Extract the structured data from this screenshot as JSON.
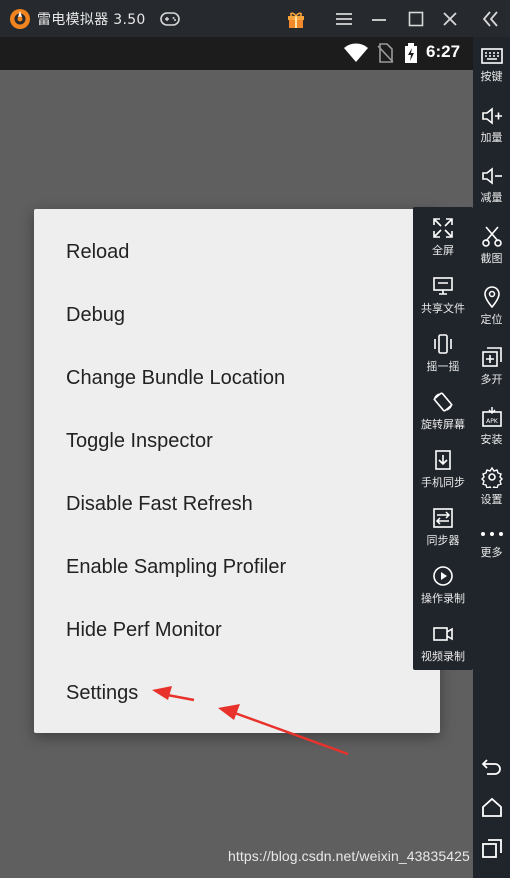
{
  "window": {
    "title": "雷电模拟器 3.50"
  },
  "statusbar": {
    "time": "6:27"
  },
  "dev_menu": {
    "items": [
      "Reload",
      "Debug",
      "Change Bundle Location",
      "Toggle Inspector",
      "Disable Fast Refresh",
      "Enable Sampling Profiler",
      "Hide Perf Monitor",
      "Settings"
    ]
  },
  "float_toolbar": {
    "items": [
      {
        "label": "全屏",
        "icon": "fullscreen-icon"
      },
      {
        "label": "共享文件",
        "icon": "share-files-icon"
      },
      {
        "label": "摇一摇",
        "icon": "shake-icon"
      },
      {
        "label": "旋转屏幕",
        "icon": "rotate-screen-icon"
      },
      {
        "label": "手机同步",
        "icon": "phone-sync-icon"
      },
      {
        "label": "同步器",
        "icon": "synchronizer-icon"
      },
      {
        "label": "操作录制",
        "icon": "operation-record-icon"
      },
      {
        "label": "视频录制",
        "icon": "video-record-icon"
      }
    ]
  },
  "sidebar": {
    "items": [
      {
        "label": "按键",
        "icon": "keyboard-icon"
      },
      {
        "label": "加量",
        "icon": "volume-up-icon"
      },
      {
        "label": "减量",
        "icon": "volume-down-icon"
      },
      {
        "label": "截图",
        "icon": "screenshot-icon"
      },
      {
        "label": "定位",
        "icon": "location-icon"
      },
      {
        "label": "多开",
        "icon": "multi-instance-icon"
      },
      {
        "label": "安装",
        "icon": "install-apk-icon"
      },
      {
        "label": "设置",
        "icon": "settings-gear-icon"
      },
      {
        "label": "更多",
        "icon": "more-icon"
      }
    ]
  },
  "watermark": "https://blog.csdn.net/weixin_43835425",
  "colors": {
    "titlebar": "#262a2f",
    "sidebar": "#20252b",
    "screen_bg": "#5f5f5f",
    "dialog_bg": "#eeeeee",
    "arrow": "#e8322b",
    "logo": "#f0841e"
  }
}
